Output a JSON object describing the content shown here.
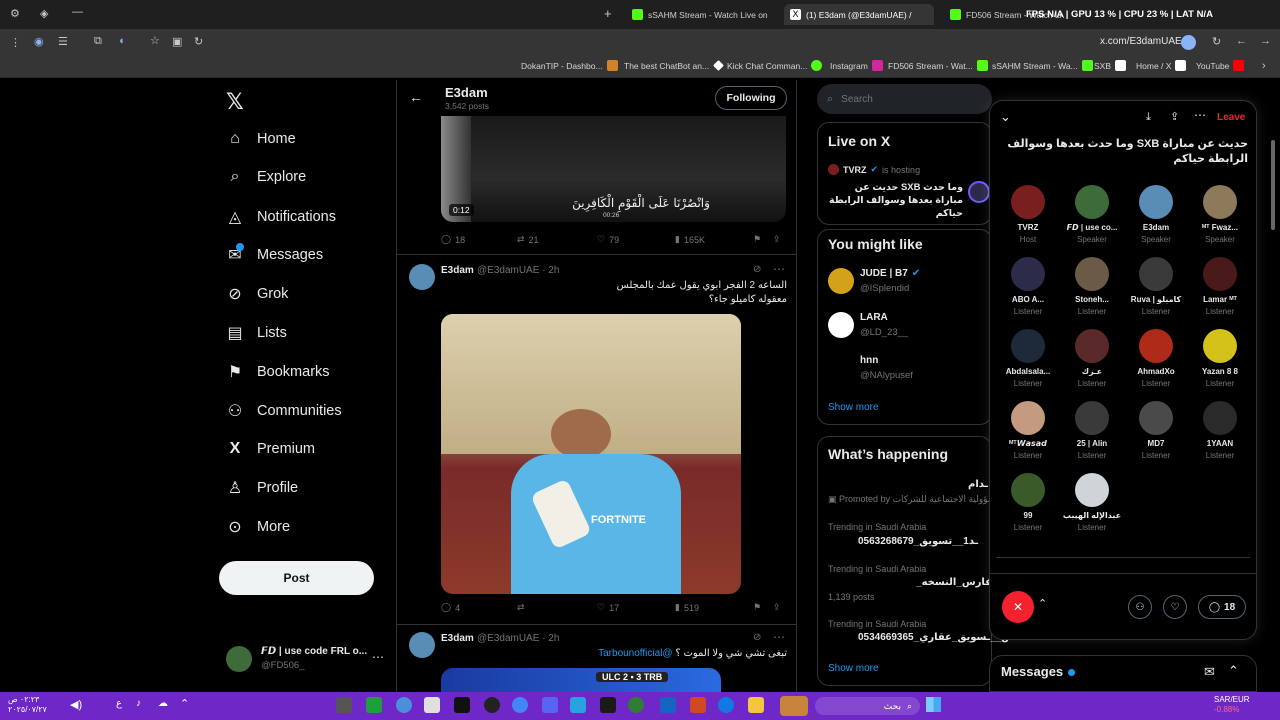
{
  "browser": {
    "tabs": [
      {
        "title": "sSAHM Stream - Watch Live on"
      },
      {
        "title": "(1) E3dam (@E3damUAE) /"
      },
      {
        "title": "FD506 Stream - Watch Live on"
      }
    ],
    "new_tab": "+",
    "overlay_stats": "FPS  N/A  |  GPU  13 %  |  CPU  23 %  |  LAT  N/A",
    "url": "x.com/E3damUAE",
    "bookmarks": [
      "DokanTIP - Dashbo...",
      "The best ChatBot an...",
      "Kick Chat Comman...",
      "Instagram",
      "FD506 Stream - Wat...",
      "sSAHM Stream - Wa...",
      "SXB",
      "Home / X",
      "YouTube"
    ]
  },
  "nav": {
    "items": [
      {
        "label": "Home",
        "icon": "home-icon"
      },
      {
        "label": "Explore",
        "icon": "search-icon"
      },
      {
        "label": "Notifications",
        "icon": "bell-icon"
      },
      {
        "label": "Messages",
        "icon": "mail-icon"
      },
      {
        "label": "Grok",
        "icon": "grok-icon"
      },
      {
        "label": "Lists",
        "icon": "list-icon"
      },
      {
        "label": "Bookmarks",
        "icon": "bookmark-icon"
      },
      {
        "label": "Communities",
        "icon": "communities-icon"
      },
      {
        "label": "Premium",
        "icon": "x-logo-icon"
      },
      {
        "label": "Profile",
        "icon": "profile-icon"
      },
      {
        "label": "More",
        "icon": "more-circle-icon"
      }
    ],
    "post_label": "Post",
    "account": {
      "name": "𝙁𝘿 | use code FRL o...",
      "handle": "@FD506_"
    }
  },
  "profile_header": {
    "name": "E3dam",
    "posts": "3,542 posts",
    "follow_label": "Following"
  },
  "feed": {
    "top_video": {
      "duration": "0:12",
      "timestamp": "00:26",
      "caption": "وَانْصُرْنَا عَلَى الْقَوْمِ الْكَافِرِينَ"
    },
    "top_actions": {
      "replies": "18",
      "reposts": "21",
      "likes": "79",
      "views": "165K"
    },
    "post1": {
      "name": "E3dam",
      "handle": "@E3damUAE · 2h",
      "text": "الساعه 2 الفجر ابوي يقول عمك بالمجلس معقوله كاميلو جاء؟",
      "jersey": "FORTNITE",
      "actions": {
        "replies": "4",
        "reposts": "",
        "likes": "17",
        "views": "519"
      }
    },
    "post2": {
      "name": "E3dam",
      "handle": "@E3damUAE · 2h",
      "mention": "@Tarbounofficial",
      "text": "تبغى تشي شي ولا الموت ؟",
      "scoreboard": "ULC  2  ▪  3  TRB"
    }
  },
  "right": {
    "search_placeholder": "Search",
    "live": {
      "title": "Live on X",
      "host": "TVRZ",
      "is_hosting": "is hosting",
      "space_title": "وما حدث SXB حديث عن مباراة بعدها وسوالف الرابطة حياكم"
    },
    "might_like": {
      "title": "You might like",
      "users": [
        {
          "name": "JUDE | B7",
          "handle": "@ISplendid"
        },
        {
          "name": "LARA",
          "handle": "@LD_23__"
        },
        {
          "name": "hnn",
          "handle": "@NAlypusef"
        }
      ],
      "show_more": "Show more"
    },
    "happening": {
      "title": "What’s happening",
      "promo_title": "ـدام",
      "promo_by": "Promoted by",
      "promo_text": "ـسؤولية الاجتماعية للشركات",
      "trends": [
        {
          "context": "Trending in Saudi Arabia",
          "name": "0563268679_ـد1__تسويق",
          "posts": ""
        },
        {
          "context": "Trending in Saudi Arabia",
          "name": "_فارس_النسخه",
          "posts": "1,139 posts"
        },
        {
          "context": "Trending in Saudi Arabia",
          "name": "0534669365_كاش__ـسويق_عقاري",
          "posts": ""
        }
      ],
      "show_more": "Show more"
    }
  },
  "space": {
    "leave_label": "Leave",
    "title": "حديث عن مباراة SXB وما حدث بعدها وسوالف الرابطة حياكم",
    "participants": [
      {
        "name": "TVRZ",
        "role": "Host",
        "color": "#7a1f1f"
      },
      {
        "name": "𝙁𝘿 | use co...",
        "role": "Speaker",
        "color": "#3d6b3a"
      },
      {
        "name": "E3dam",
        "role": "Speaker",
        "color": "#5a8db5"
      },
      {
        "name": "ᴹᵀ Fwaz...",
        "role": "Speaker",
        "color": "#8c7a5a"
      },
      {
        "name": "ABO A...",
        "role": "Listener",
        "color": "#2c2c4a"
      },
      {
        "name": "Stoneh...",
        "role": "Listener",
        "color": "#6b5a46"
      },
      {
        "name": "Ruva | كامبلو",
        "role": "Listener",
        "color": "#3a3a3a"
      },
      {
        "name": "Lamar ᴹᵀ",
        "role": "Listener",
        "color": "#4a1a1a"
      },
      {
        "name": "Abdalsala...",
        "role": "Listener",
        "color": "#1e2a3a"
      },
      {
        "name": "عـزك",
        "role": "Listener",
        "color": "#5a2a2a"
      },
      {
        "name": "AhmadXo",
        "role": "Listener",
        "color": "#b02a1a"
      },
      {
        "name": "Yazan 8 8",
        "role": "Listener",
        "color": "#d4c21a"
      },
      {
        "name": "ᴹᵀ𝙒𝙖𝙨𝙖𝙙",
        "role": "Listener",
        "color": "#c49a80"
      },
      {
        "name": "25 | Alin",
        "role": "Listener",
        "color": "#3a3a3a"
      },
      {
        "name": "MD7",
        "role": "Listener",
        "color": "#4a4a4a"
      },
      {
        "name": "1YAAN",
        "role": "Listener",
        "color": "#2a2a2a"
      },
      {
        "name": "99",
        "role": "Listener",
        "color": "#3a5a2a"
      },
      {
        "name": "عبدالإله الهيبب",
        "role": "Listener",
        "color": "#cfd4d9"
      }
    ],
    "comment_count": "18"
  },
  "messages_bar": {
    "title": "Messages"
  },
  "taskbar": {
    "search_placeholder": "بحث",
    "clock_time": "٠٢:٢٣ ص",
    "clock_date": "٢٠٢٥/٠٧/٢٧",
    "currency": "SAR/EUR",
    "currency_val": "-0.88%"
  }
}
